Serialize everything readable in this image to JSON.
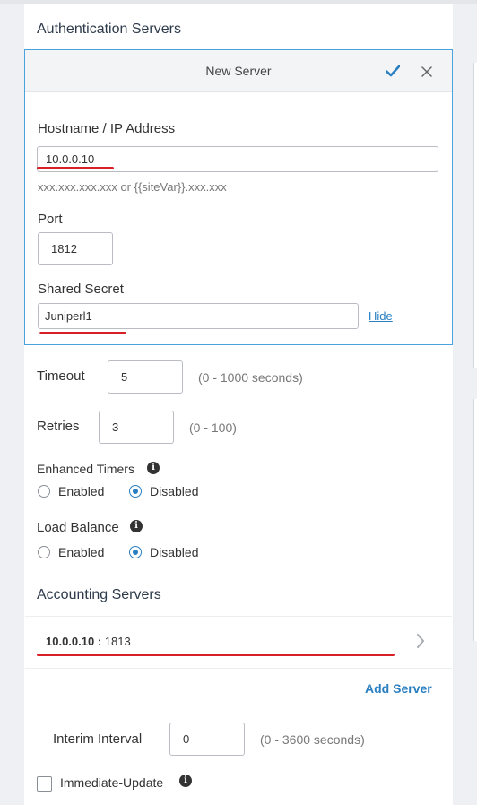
{
  "auth": {
    "section_title": "Authentication Servers",
    "new_server": {
      "title": "New Server",
      "hostname_label": "Hostname / IP Address",
      "hostname_value": "10.0.0.10",
      "hostname_hint": "xxx.xxx.xxx.xxx or {{siteVar}}.xxx.xxx",
      "port_label": "Port",
      "port_value": "1812",
      "secret_label": "Shared Secret",
      "secret_value": "Juniperl1",
      "hide_link": "Hide"
    },
    "timeout_label": "Timeout",
    "timeout_value": "5",
    "timeout_hint": "(0 - 1000 seconds)",
    "retries_label": "Retries",
    "retries_value": "3",
    "retries_hint": "(0 - 100)",
    "enhanced_timers": {
      "label": "Enhanced Timers",
      "enabled_label": "Enabled",
      "disabled_label": "Disabled",
      "selected": "Disabled"
    },
    "load_balance": {
      "label": "Load Balance",
      "enabled_label": "Enabled",
      "disabled_label": "Disabled",
      "selected": "Disabled"
    }
  },
  "acct": {
    "section_title": "Accounting Servers",
    "server_host": "10.0.0.10",
    "server_sep": " : ",
    "server_port": "1813",
    "add_server": "Add Server",
    "interim_label": "Interim Interval",
    "interim_value": "0",
    "interim_hint": "(0 - 3600 seconds)",
    "immediate_update_label": "Immediate-Update"
  },
  "colors": {
    "accent": "#2a7fc1",
    "annotation_red": "#d91f26",
    "focus_border": "#4aa3df"
  },
  "icons": {
    "confirm": "check-icon",
    "close": "close-icon",
    "info": "info-icon",
    "chevron": "chevron-right-icon"
  }
}
